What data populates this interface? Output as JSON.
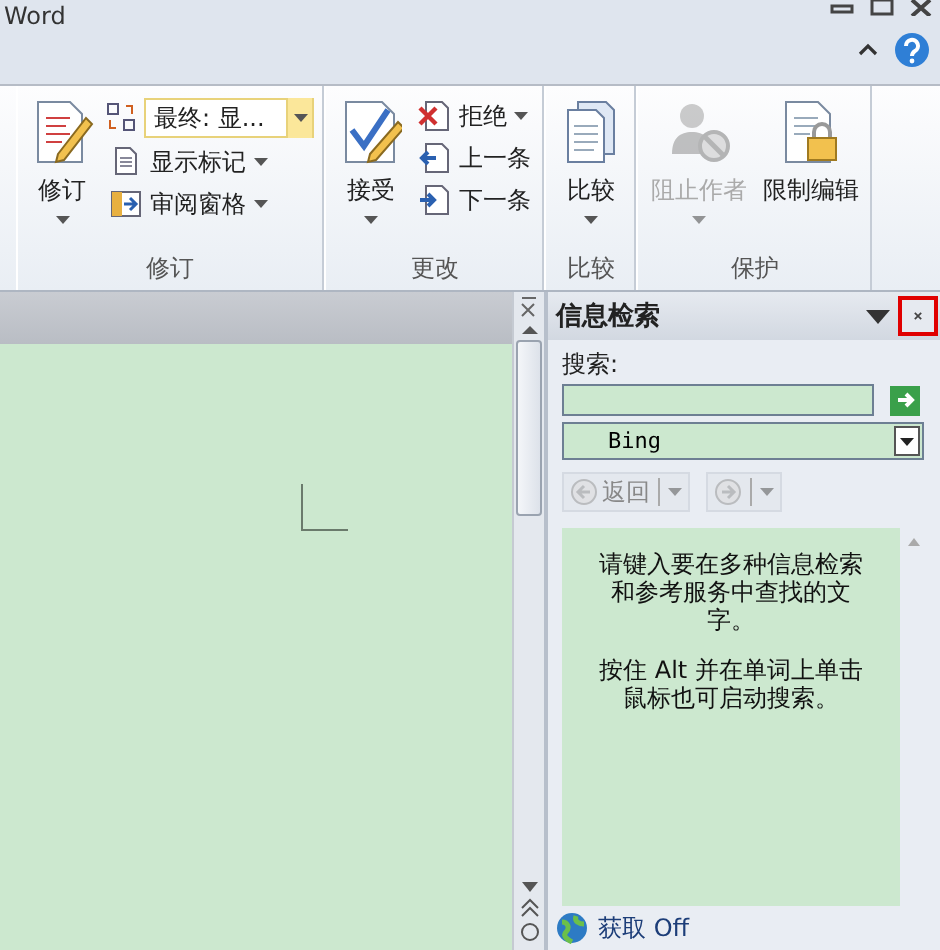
{
  "window": {
    "title": "Word"
  },
  "ribbon": {
    "groups": [
      {
        "label": "修订",
        "large_buttons": [
          {
            "label": "修订",
            "has_menu": true,
            "disabled": false
          }
        ],
        "small_buttons": [
          {
            "kind": "combo",
            "label": "最终: 显...",
            "has_menu": true
          },
          {
            "kind": "button",
            "label": "显示标记",
            "has_menu": true
          },
          {
            "kind": "button",
            "label": "审阅窗格",
            "has_menu": true
          }
        ]
      },
      {
        "label": "更改",
        "large_buttons": [
          {
            "label": "接受",
            "has_menu": true,
            "disabled": false
          }
        ],
        "small_buttons": [
          {
            "kind": "button",
            "label": "拒绝",
            "has_menu": true
          },
          {
            "kind": "button",
            "label": "上一条",
            "has_menu": false
          },
          {
            "kind": "button",
            "label": "下一条",
            "has_menu": false
          }
        ]
      },
      {
        "label": "比较",
        "large_buttons": [
          {
            "label": "比较",
            "has_menu": true,
            "disabled": false
          }
        ]
      },
      {
        "label": "保护",
        "large_buttons": [
          {
            "label": "阻止作者",
            "has_menu": true,
            "disabled": true
          },
          {
            "label": "限制编辑",
            "has_menu": false,
            "disabled": false
          }
        ]
      }
    ]
  },
  "task_pane": {
    "title": "信息检索",
    "search_label": "搜索:",
    "source": "Bing",
    "back_button": {
      "label": "返回",
      "disabled": true
    },
    "forward_button": {
      "disabled": true
    },
    "message": [
      "请键入要在多种信息检索和参考服务中查找的文字。",
      "按住 Alt 并在单词上单击鼠标也可启动搜索。"
    ],
    "footer_link": "获取 Off"
  }
}
